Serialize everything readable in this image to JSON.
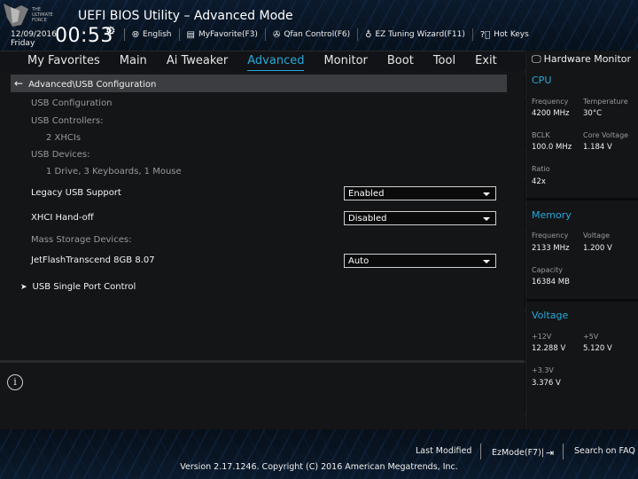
{
  "header": {
    "title": "UEFI BIOS Utility – Advanced Mode",
    "date": "12/09/2016",
    "day": "Friday",
    "time": "00:53",
    "logo_text": "THE ULTIMATE FORCE",
    "items": [
      {
        "icon": "globe-icon",
        "label": "English"
      },
      {
        "icon": "favorite-icon",
        "label": "MyFavorite(F3)"
      },
      {
        "icon": "fan-icon",
        "label": "Qfan Control(F6)"
      },
      {
        "icon": "bulb-icon",
        "label": "EZ Tuning Wizard(F11)"
      },
      {
        "icon": "help-icon",
        "label": "Hot Keys"
      }
    ]
  },
  "menu": {
    "items": [
      "My Favorites",
      "Main",
      "Ai Tweaker",
      "Advanced",
      "Monitor",
      "Boot",
      "Tool",
      "Exit"
    ],
    "active": "Advanced"
  },
  "main": {
    "breadcrumb": "Advanced\\USB Configuration",
    "usb_config_label": "USB Configuration",
    "controllers_label": "USB Controllers:",
    "controllers_value": "2 XHCIs",
    "devices_label": "USB Devices:",
    "devices_value": "1 Drive, 3 Keyboards, 1 Mouse",
    "legacy_label": "Legacy USB Support",
    "legacy_value": "Enabled",
    "xhci_label": "XHCI Hand-off",
    "xhci_value": "Disabled",
    "mass_label": "Mass Storage Devices:",
    "jetflash_label": "JetFlashTranscend 8GB 8.07",
    "jetflash_value": "Auto",
    "single_port_label": "USB Single Port Control"
  },
  "hwmon": {
    "title": "Hardware Monitor",
    "cpu": {
      "section": "CPU",
      "frequency_label": "Frequency",
      "frequency_value": "4200 MHz",
      "temperature_label": "Temperature",
      "temperature_value": "30°C",
      "bclk_label": "BCLK",
      "bclk_value": "100.0 MHz",
      "core_voltage_label": "Core Voltage",
      "core_voltage_value": "1.184 V",
      "ratio_label": "Ratio",
      "ratio_value": "42x"
    },
    "memory": {
      "section": "Memory",
      "frequency_label": "Frequency",
      "frequency_value": "2133 MHz",
      "voltage_label": "Voltage",
      "voltage_value": "1.200 V",
      "capacity_label": "Capacity",
      "capacity_value": "16384 MB"
    },
    "voltage": {
      "section": "Voltage",
      "v12_label": "+12V",
      "v12_value": "12.288 V",
      "v5_label": "+5V",
      "v5_value": "5.120 V",
      "v33_label": "+3.3V",
      "v33_value": "3.376 V"
    }
  },
  "footer": {
    "last_modified": "Last Modified",
    "ezmode": "EzMode(F7)|",
    "search": "Search on FAQ",
    "copyright": "Version 2.17.1246. Copyright (C) 2016 American Megatrends, Inc."
  },
  "colors": {
    "accent": "#2aa8d8",
    "panel": "#141517",
    "breadcrumb": "#3c3d40"
  }
}
